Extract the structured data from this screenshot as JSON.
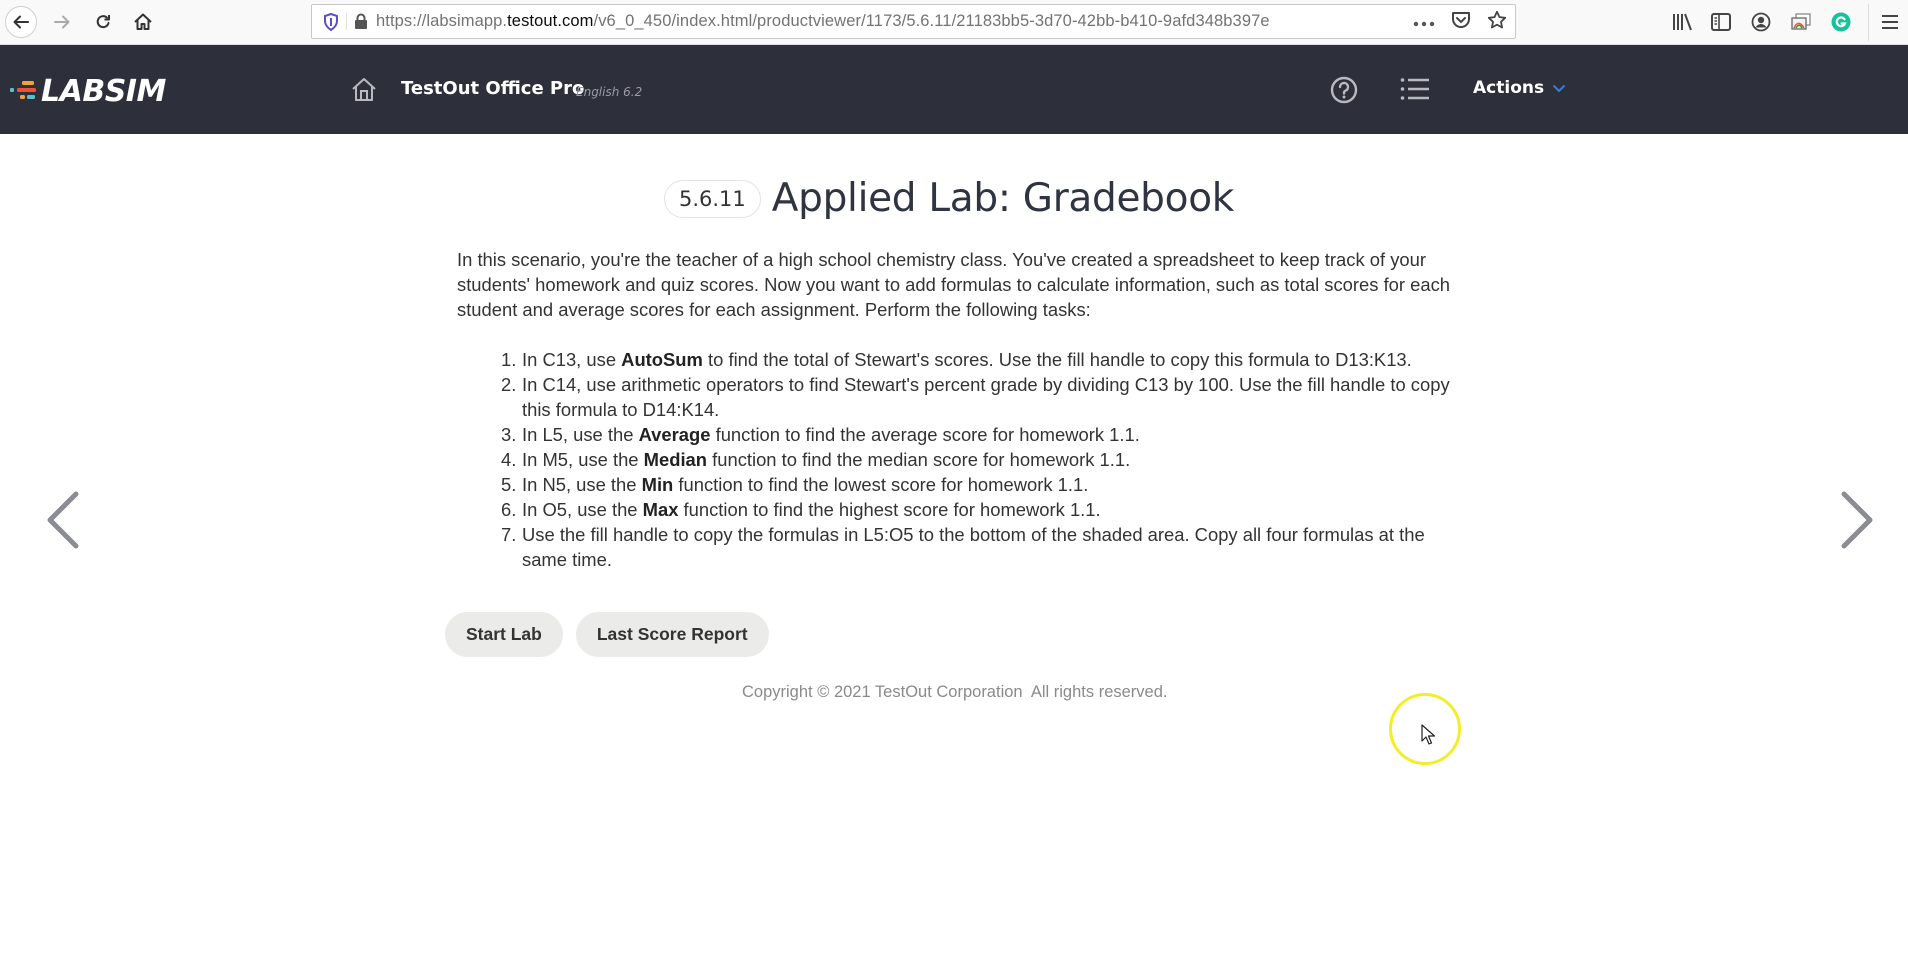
{
  "browser": {
    "url_prefix": "https://labsimapp.",
    "url_domain": "testout.com",
    "url_path": "/v6_0_450/index.html/productviewer/1173/5.6.11/21183bb5-3d70-42bb-b410-9afd348b397e",
    "icons": [
      "back-icon",
      "forward-icon",
      "reload-icon",
      "home-icon",
      "tracking-shield-icon",
      "lock-icon",
      "page-actions-icon",
      "pocket-icon",
      "bookmark-star-icon",
      "library-icon",
      "sidebar-icon",
      "account-icon",
      "screenshot-icon",
      "grammarly-icon",
      "menu-icon"
    ]
  },
  "header": {
    "logo_text": "LABSIM",
    "product_title": "TestOut Office Pro",
    "product_version": "English 6.2",
    "actions_label": "Actions",
    "accent_color": "#3d7bd9",
    "background_color": "#2d2f3b"
  },
  "page": {
    "section_number": "5.6.11",
    "title": "Applied Lab: Gradebook",
    "intro": "In this scenario, you're the teacher of a high school chemistry class. You've created a spreadsheet to keep track of your students' homework and quiz scores. Now you want to add formulas to calculate information, such as total scores for each student and average scores for each assignment. Perform the following tasks:",
    "tasks": [
      {
        "num": "1.",
        "before": "In C13, use ",
        "bold": "AutoSum",
        "after": " to find the total of Stewart's scores. Use the fill handle to copy this formula to D13:K13."
      },
      {
        "num": "2.",
        "before": "In C14, use arithmetic operators to find Stewart's percent grade by dividing C13 by 100. Use the fill handle to copy this formula to D14:K14.",
        "bold": "",
        "after": ""
      },
      {
        "num": "3.",
        "before": "In L5, use the ",
        "bold": "Average",
        "after": " function to find the average score for homework 1.1."
      },
      {
        "num": "4.",
        "before": "In M5, use the ",
        "bold": "Median",
        "after": " function to find the median score for homework 1.1."
      },
      {
        "num": "5.",
        "before": "In N5, use the ",
        "bold": "Min",
        "after": " function to find the lowest score for homework 1.1."
      },
      {
        "num": "6.",
        "before": "In O5, use the ",
        "bold": "Max",
        "after": " function to find the highest score for homework 1.1."
      },
      {
        "num": "7.",
        "before": "Use the fill handle to copy the formulas in L5:O5 to the bottom of the shaded area. Copy all four formulas at the same time.",
        "bold": "",
        "after": ""
      }
    ],
    "buttons": {
      "start_lab": "Start Lab",
      "last_score_report": "Last Score Report"
    },
    "copyright": "Copyright © 2021 TestOut Corporation  All rights reserved."
  },
  "navigation": {
    "prev_icon": "chevron-left-icon",
    "next_icon": "chevron-right-icon"
  }
}
